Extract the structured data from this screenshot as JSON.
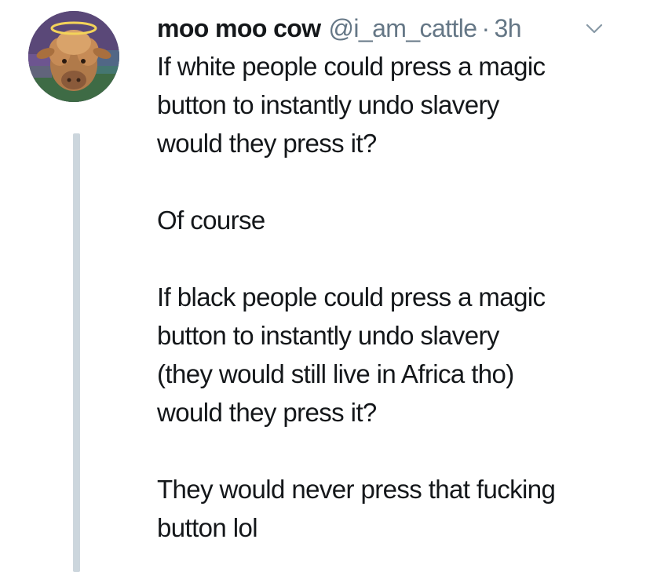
{
  "tweet": {
    "display_name": "moo moo cow",
    "handle": "@i_am_cattle",
    "separator": "·",
    "time": "3h",
    "avatar_icon": "cow-with-halo-avatar",
    "menu_icon": "chevron-down-icon",
    "colors": {
      "text": "#14171a",
      "secondary_text": "#657786",
      "thread_line": "#ccd6dd"
    },
    "body": {
      "p1": [
        "If white people could press a magic",
        "button to instantly undo slavery",
        "would they press it?"
      ],
      "p2": [
        "Of course"
      ],
      "p3": [
        "If black people could press a magic",
        "button to instantly undo slavery",
        "(they would still live in Africa tho)",
        "would they press it?"
      ],
      "p4": [
        "They would never press that fucking",
        "button lol"
      ]
    }
  }
}
